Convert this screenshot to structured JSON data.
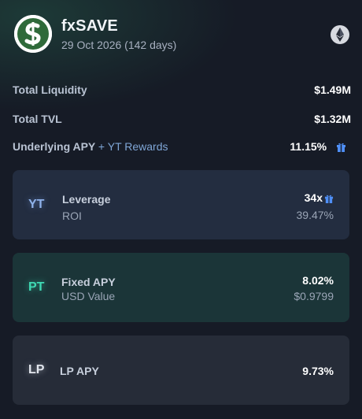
{
  "header": {
    "title": "fxSAVE",
    "subtitle": "29 Oct 2026 (142 days)",
    "logo_icon": "fxsave-dollar-logo",
    "network_icon": "ethereum-icon"
  },
  "stats": {
    "total_liquidity": {
      "label": "Total Liquidity",
      "value": "$1.49M"
    },
    "total_tvl": {
      "label": "Total TVL",
      "value": "$1.32M"
    },
    "underlying_apy": {
      "label": "Underlying APY",
      "extra": "+ YT Rewards",
      "value": "11.15%",
      "icon": "gift-icon"
    }
  },
  "cards": {
    "yt": {
      "badge": "YT",
      "label": "Leverage",
      "sublabel": "ROI",
      "value": "34x",
      "subvalue": "39.47%",
      "icon": "gift-icon"
    },
    "pt": {
      "badge": "PT",
      "label": "Fixed APY",
      "sublabel": "USD Value",
      "value": "8.02%",
      "subvalue": "$0.9799"
    },
    "lp": {
      "badge": "LP",
      "label": "LP APY",
      "value": "9.73%"
    }
  },
  "colors": {
    "background": "#161b26",
    "yt_card": "#232d40",
    "pt_card": "#1b3538",
    "lp_card": "#262c38",
    "yt_accent": "#8fb2ea",
    "pt_accent": "#3fd9b4",
    "gift_accent": "#4f8ff7"
  }
}
